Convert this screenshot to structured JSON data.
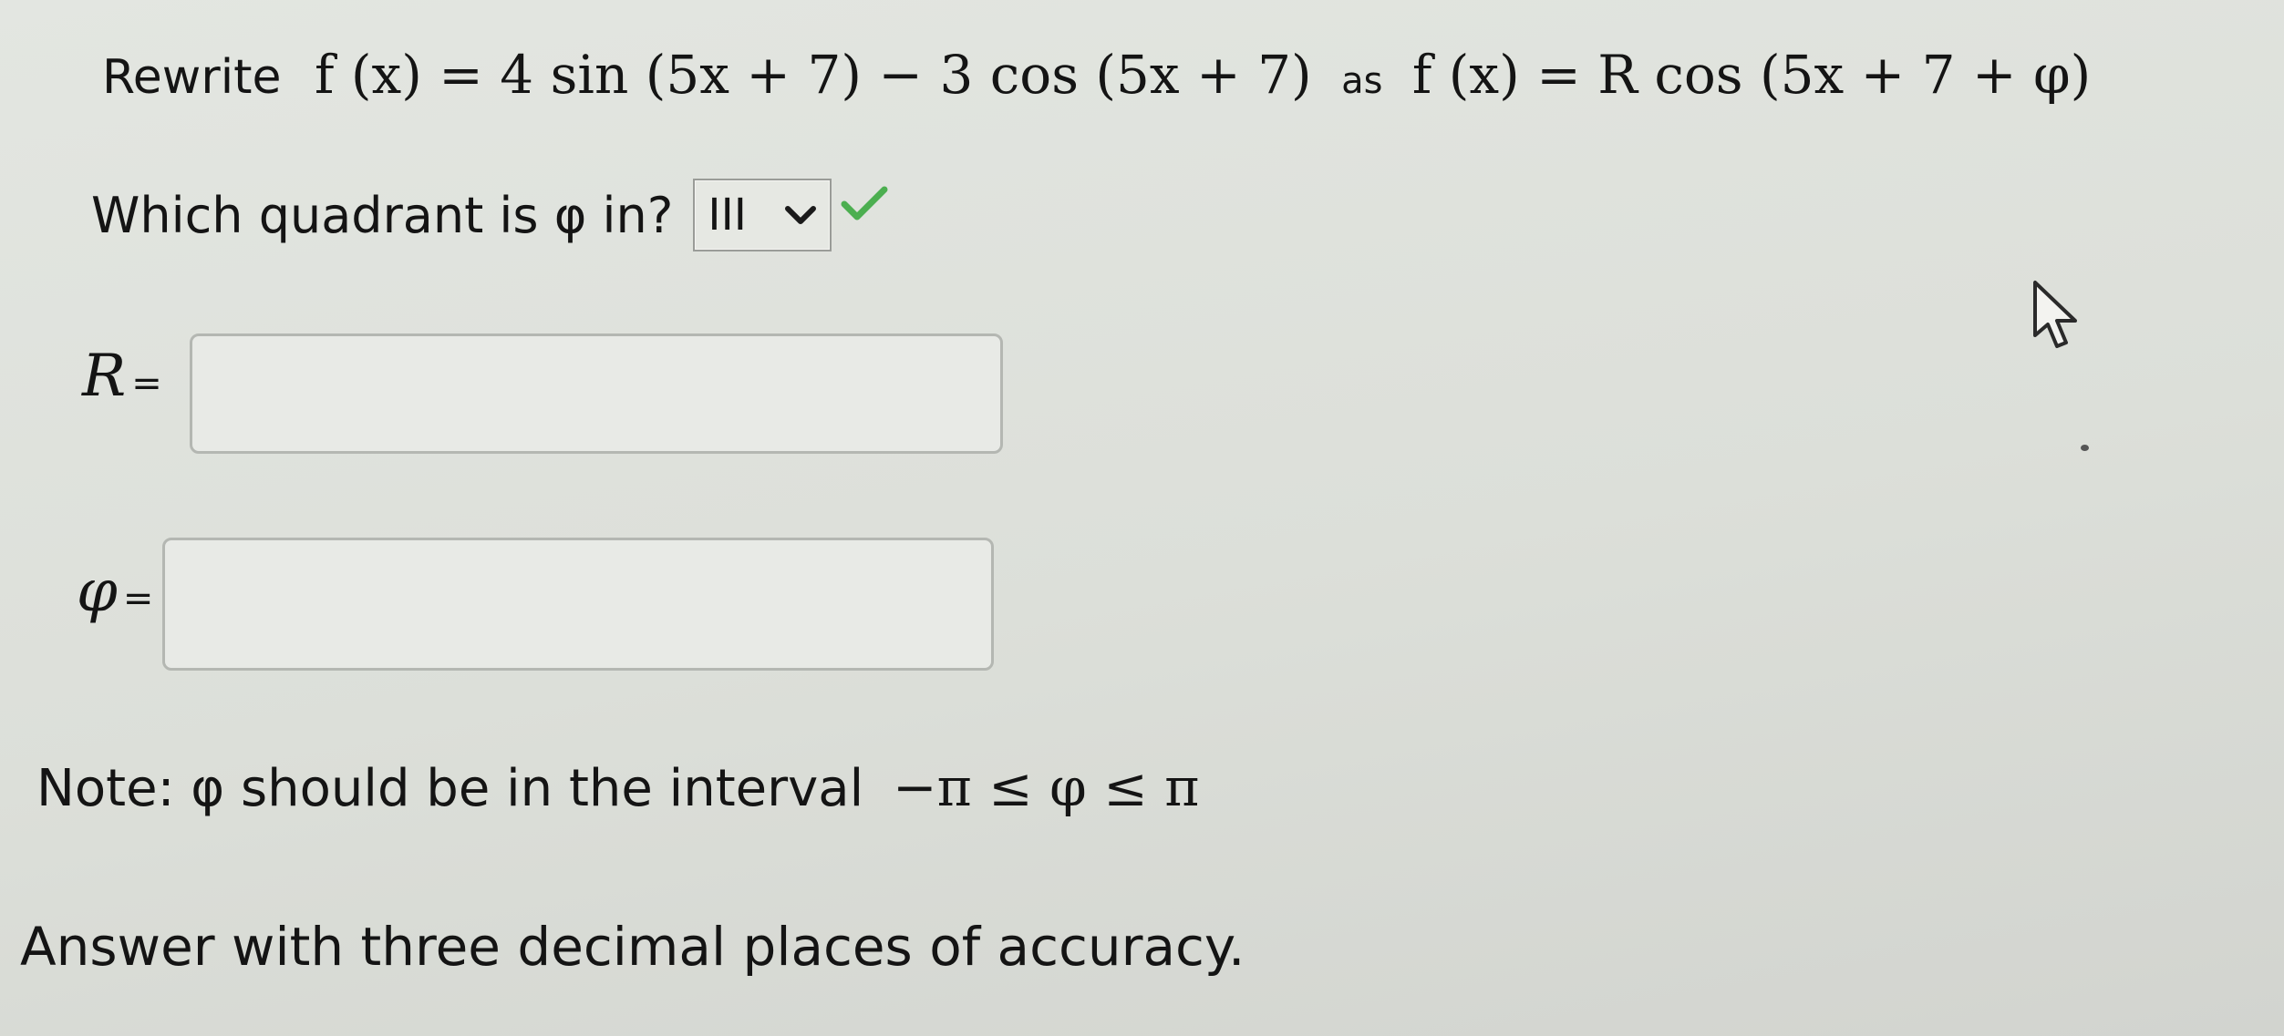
{
  "problem": {
    "prefix": "Rewrite",
    "given_expression": "f (x) = 4 sin (5x + 7) − 3 cos (5x + 7)",
    "connector": "as",
    "target_expression": "f (x) = R cos (5x + 7 + φ)"
  },
  "quadrant_question": {
    "label": "Which quadrant is φ in?",
    "selected_value": "III",
    "status_color": "#4caf50"
  },
  "r_field": {
    "label": "R",
    "equals": "=",
    "value": ""
  },
  "phi_field": {
    "label": "φ",
    "equals": "=",
    "value": ""
  },
  "note": {
    "text": "Note: φ should be in the interval",
    "interval": "−π ≤ φ ≤ π"
  },
  "instruction": "Answer with three decimal places of accuracy."
}
